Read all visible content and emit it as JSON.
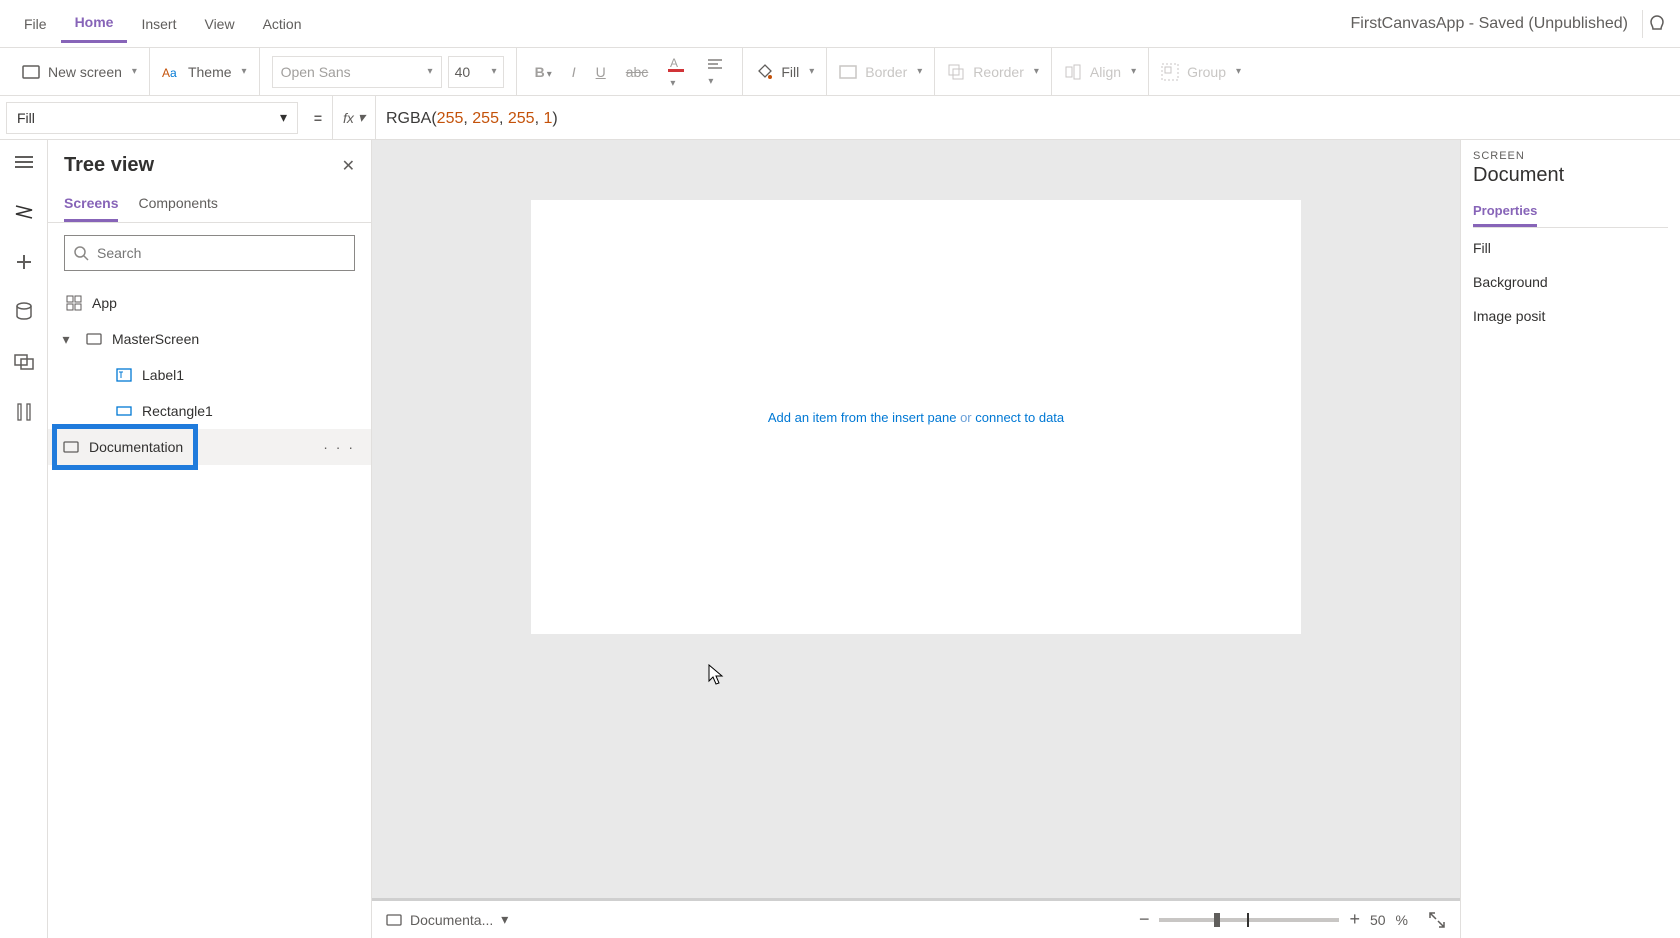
{
  "menu": {
    "file": "File",
    "home": "Home",
    "insert": "Insert",
    "view": "View",
    "action": "Action",
    "app_title": "FirstCanvasApp - Saved (Unpublished)"
  },
  "ribbon": {
    "new_screen": "New screen",
    "theme": "Theme",
    "font_name": "Open Sans",
    "font_size": "40",
    "fill": "Fill",
    "border": "Border",
    "reorder": "Reorder",
    "align": "Align",
    "group": "Group"
  },
  "formula": {
    "property": "Fill",
    "fx": "fx",
    "expr_fn": "RGBA",
    "expr_open": "(",
    "expr_n1": "255",
    "expr_c": ", ",
    "expr_n2": "255",
    "expr_n3": "255",
    "expr_n4": "1",
    "expr_close": ")"
  },
  "tree": {
    "title": "Tree view",
    "tab_screens": "Screens",
    "tab_components": "Components",
    "search_placeholder": "Search",
    "node_app": "App",
    "node_master": "MasterScreen",
    "node_label1": "Label1",
    "node_rect1": "Rectangle1",
    "node_doc": "Documentation"
  },
  "canvas": {
    "hint_a": "Add an item from the insert pane",
    "hint_or": " or ",
    "hint_b": "connect to data"
  },
  "status": {
    "screen_short": "Documenta...",
    "zoom_value": "50",
    "zoom_pct": "%"
  },
  "right": {
    "label": "SCREEN",
    "screen_name": "Document",
    "tab_props": "Properties",
    "prop_fill": "Fill",
    "prop_bg": "Background",
    "prop_imgpos": "Image posit"
  }
}
